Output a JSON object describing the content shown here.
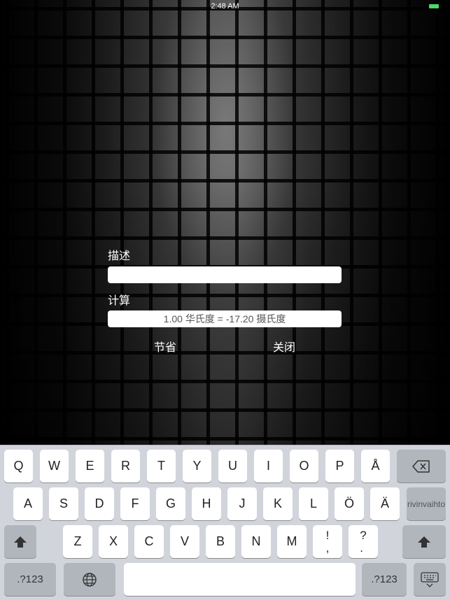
{
  "status_bar": {
    "time": "2:48 AM"
  },
  "form": {
    "description_label": "描述",
    "description_value": "",
    "calc_label": "计算",
    "calc_value": "1.00 华氏度 = -17.20 摄氏度",
    "save_label": "节省",
    "close_label": "关闭"
  },
  "keyboard": {
    "row1": [
      "Q",
      "W",
      "E",
      "R",
      "T",
      "Y",
      "U",
      "I",
      "O",
      "P",
      "Å"
    ],
    "row2": [
      "A",
      "S",
      "D",
      "F",
      "G",
      "H",
      "J",
      "K",
      "L",
      "Ö",
      "Ä"
    ],
    "row3": [
      "Z",
      "X",
      "C",
      "V",
      "B",
      "N",
      "M",
      "!,",
      "?."
    ],
    "return_label": "rivinvaihto",
    "numbers_label": ".?123",
    "icons": {
      "backspace": "backspace-icon",
      "shift": "shift-icon",
      "globe": "globe-icon",
      "dismiss": "keyboard-dismiss-icon"
    }
  }
}
